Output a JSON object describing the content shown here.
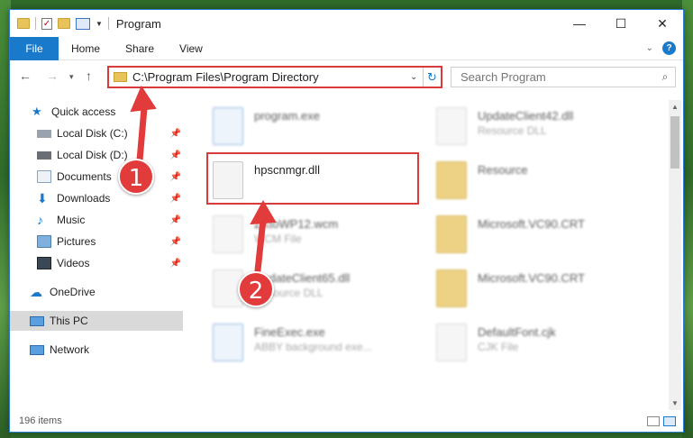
{
  "window": {
    "title": "Program",
    "min": "—",
    "max": "☐",
    "close": "✕"
  },
  "ribbon": {
    "file": "File",
    "tabs": [
      "Home",
      "Share",
      "View"
    ]
  },
  "address": {
    "path": "C:\\Program Files\\Program Directory",
    "search_placeholder": "Search Program"
  },
  "sidebar": {
    "items": [
      {
        "label": "Quick access"
      },
      {
        "label": "Local Disk (C:)"
      },
      {
        "label": "Local Disk (D:)"
      },
      {
        "label": "Documents"
      },
      {
        "label": "Downloads"
      },
      {
        "label": "Music"
      },
      {
        "label": "Pictures"
      },
      {
        "label": "Videos"
      },
      {
        "label": "OneDrive"
      },
      {
        "label": "This PC"
      },
      {
        "label": "Network"
      }
    ]
  },
  "files": [
    {
      "name": "program.exe",
      "desc": ""
    },
    {
      "name": "UpdateClient42.dll",
      "desc": "Resource DLL"
    },
    {
      "name": "hpscnmgr.dll",
      "desc": ""
    },
    {
      "name": "Resource",
      "desc": ""
    },
    {
      "name": "ZXtoWP12.wcm",
      "desc": "WCM File"
    },
    {
      "name": "Microsoft.VC90.CRT",
      "desc": ""
    },
    {
      "name": "UpdateClient65.dll",
      "desc": "Resource DLL"
    },
    {
      "name": "Microsoft.VC90.CRT",
      "desc": ""
    },
    {
      "name": "FineExec.exe",
      "desc": "ABBY background exe..."
    },
    {
      "name": "DefaultFont.cjk",
      "desc": "CJK File"
    }
  ],
  "status": {
    "count": "196 items"
  },
  "annotations": {
    "step1": "1",
    "step2": "2",
    "color": "#e23b3b"
  }
}
